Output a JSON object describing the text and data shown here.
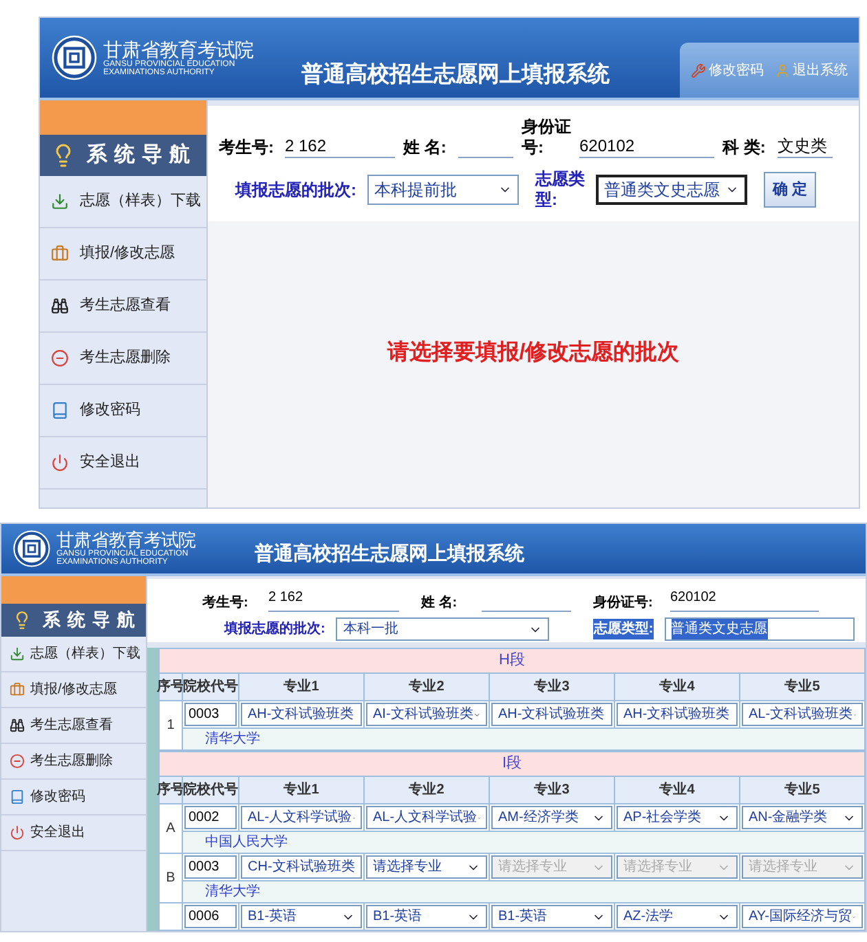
{
  "screens": [
    {
      "kind": "batch_prompt",
      "org_name": "甘肃省教育考试院",
      "org_name_en": "GANSU PROVINCIAL EDUCATION EXAMINATIONS AUTHORITY",
      "system_title": "普通高校招生志愿网上填报系统",
      "header_links": [
        {
          "label": "修改密码"
        },
        {
          "label": "退出系统"
        }
      ],
      "nav_title": "系统导航",
      "nav_items": [
        {
          "label": "志愿（样表）下载"
        },
        {
          "label": "填报/修改志愿"
        },
        {
          "label": "考生志愿查看"
        },
        {
          "label": "考生志愿删除"
        },
        {
          "label": "修改密码"
        },
        {
          "label": "安全退出"
        }
      ],
      "fields": [
        {
          "label": "考生号:",
          "value": "2 162"
        },
        {
          "label": "姓 名:"
        },
        {
          "label": "身份证号:",
          "value": "620102"
        },
        {
          "label": "科 类:",
          "value": "文史类"
        }
      ],
      "batch": {
        "label": "填报志愿的批次:",
        "value": "本科提前批"
      },
      "volunteer_type": {
        "label": "志愿类型:",
        "value": "普通类文史志愿",
        "highlighted": false
      },
      "confirm_button": "确 定",
      "message": "请选择要填报/修改志愿的批次"
    },
    {
      "kind": "volunteer_form",
      "org_name": "甘肃省教育考试院",
      "org_name_en": "GANSU PROVINCIAL EDUCATION EXAMINATIONS AUTHORITY",
      "system_title": "普通高校招生志愿网上填报系统",
      "nav_title": "系统导航",
      "nav_items": [
        {
          "label": "志愿（样表）下载"
        },
        {
          "label": "填报/修改志愿"
        },
        {
          "label": "考生志愿查看"
        },
        {
          "label": "考生志愿删除"
        },
        {
          "label": "修改密码"
        },
        {
          "label": "安全退出"
        }
      ],
      "fields": [
        {
          "label": "考生号:",
          "value": "2 162"
        },
        {
          "label": "姓 名:"
        },
        {
          "label": "身份证号:",
          "value": "620102"
        }
      ],
      "batch": {
        "label": "填报志愿的批次:",
        "value": "本科一批"
      },
      "volunteer_type": {
        "label": "志愿类型:",
        "value": "普通类文史志愿",
        "highlighted": true
      },
      "sections": [
        {
          "title": "H段",
          "columns": [
            "序号",
            "院校代号",
            "专业1",
            "专业2",
            "专业3",
            "专业4",
            "专业5"
          ],
          "rows": [
            {
              "seq": "1",
              "code": "0003",
              "school": "清华大学",
              "majors": [
                {
                  "value": "AH-文科试验班类",
                  "disabled": false
                },
                {
                  "value": "AI-文科试验班类",
                  "disabled": false
                },
                {
                  "value": "AH-文科试验班类",
                  "disabled": false
                },
                {
                  "value": "AH-文科试验班类",
                  "disabled": false
                },
                {
                  "value": "AL-文科试验班类",
                  "disabled": false
                }
              ]
            }
          ]
        },
        {
          "title": "I段",
          "columns": [
            "序号",
            "院校代号",
            "专业1",
            "专业2",
            "专业3",
            "专业4",
            "专业5"
          ],
          "rows": [
            {
              "seq": "A",
              "code": "0002",
              "school": "中国人民大学",
              "majors": [
                {
                  "value": "AL-人文科学试验",
                  "disabled": false
                },
                {
                  "value": "AL-人文科学试验",
                  "disabled": false
                },
                {
                  "value": "AM-经济学类",
                  "disabled": false
                },
                {
                  "value": "AP-社会学类",
                  "disabled": false
                },
                {
                  "value": "AN-金融学类",
                  "disabled": false
                }
              ]
            },
            {
              "seq": "B",
              "code": "0003",
              "school": "清华大学",
              "majors": [
                {
                  "value": "CH-文科试验班类",
                  "disabled": false
                },
                {
                  "value": "请选择专业",
                  "disabled": false
                },
                {
                  "value": "请选择专业",
                  "disabled": true
                },
                {
                  "value": "请选择专业",
                  "disabled": true
                },
                {
                  "value": "请选择专业",
                  "disabled": true
                }
              ]
            },
            {
              "code": "0006",
              "majors": [
                {
                  "value": "B1-英语",
                  "disabled": false
                },
                {
                  "value": "B1-英语",
                  "disabled": false
                },
                {
                  "value": "B1-英语",
                  "disabled": false
                },
                {
                  "value": "AZ-法学",
                  "disabled": false
                },
                {
                  "value": "AY-国际经济与贸",
                  "disabled": false
                }
              ]
            }
          ]
        }
      ]
    }
  ]
}
